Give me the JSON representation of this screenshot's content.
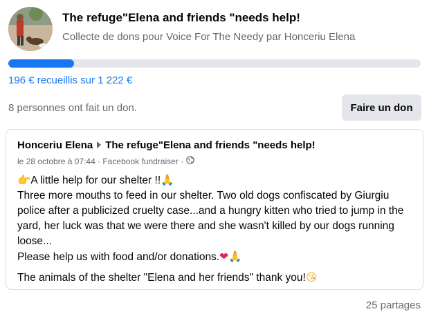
{
  "fundraiser": {
    "title": "The refuge\"Elena and friends \"needs help!",
    "subtitle": "Collecte de dons pour Voice For The Needy par Honceriu Elena",
    "progress_fraction": 0.16,
    "raised_text": "196 € recueillis sur 1 222 €",
    "donors_text": "8 personnes ont fait un don.",
    "donate_label": "Faire un don"
  },
  "post": {
    "author": "Honceriu Elena",
    "target": "The refuge\"Elena and friends \"needs help!",
    "meta": "le 28 octobre à 07:44 · Facebook fundraiser ·",
    "line1_text": "A little help for our shelter !!",
    "line2": "Three more mouths to feed in our shelter. Two old dogs confiscated by Giurgiu police after a publicized cruelty case...and a hungry kitten who tried to jump in the yard, her luck was that we were there and she wasn't killed by our dogs running loose...",
    "line3_text": "Please help us with food and/or donations.",
    "line4_text": "The animals of the shelter \"Elena and her friends\" thank you!"
  },
  "footer": {
    "shares": "25 partages"
  },
  "colors": {
    "accent": "#1877f2",
    "muted_text": "#65676b",
    "button_bg": "#e4e6eb"
  },
  "icons": [
    "pointing-hand-icon",
    "praying-hands-icon",
    "heart-icon",
    "kiss-face-icon",
    "globe-icon",
    "triangle-right-icon"
  ]
}
